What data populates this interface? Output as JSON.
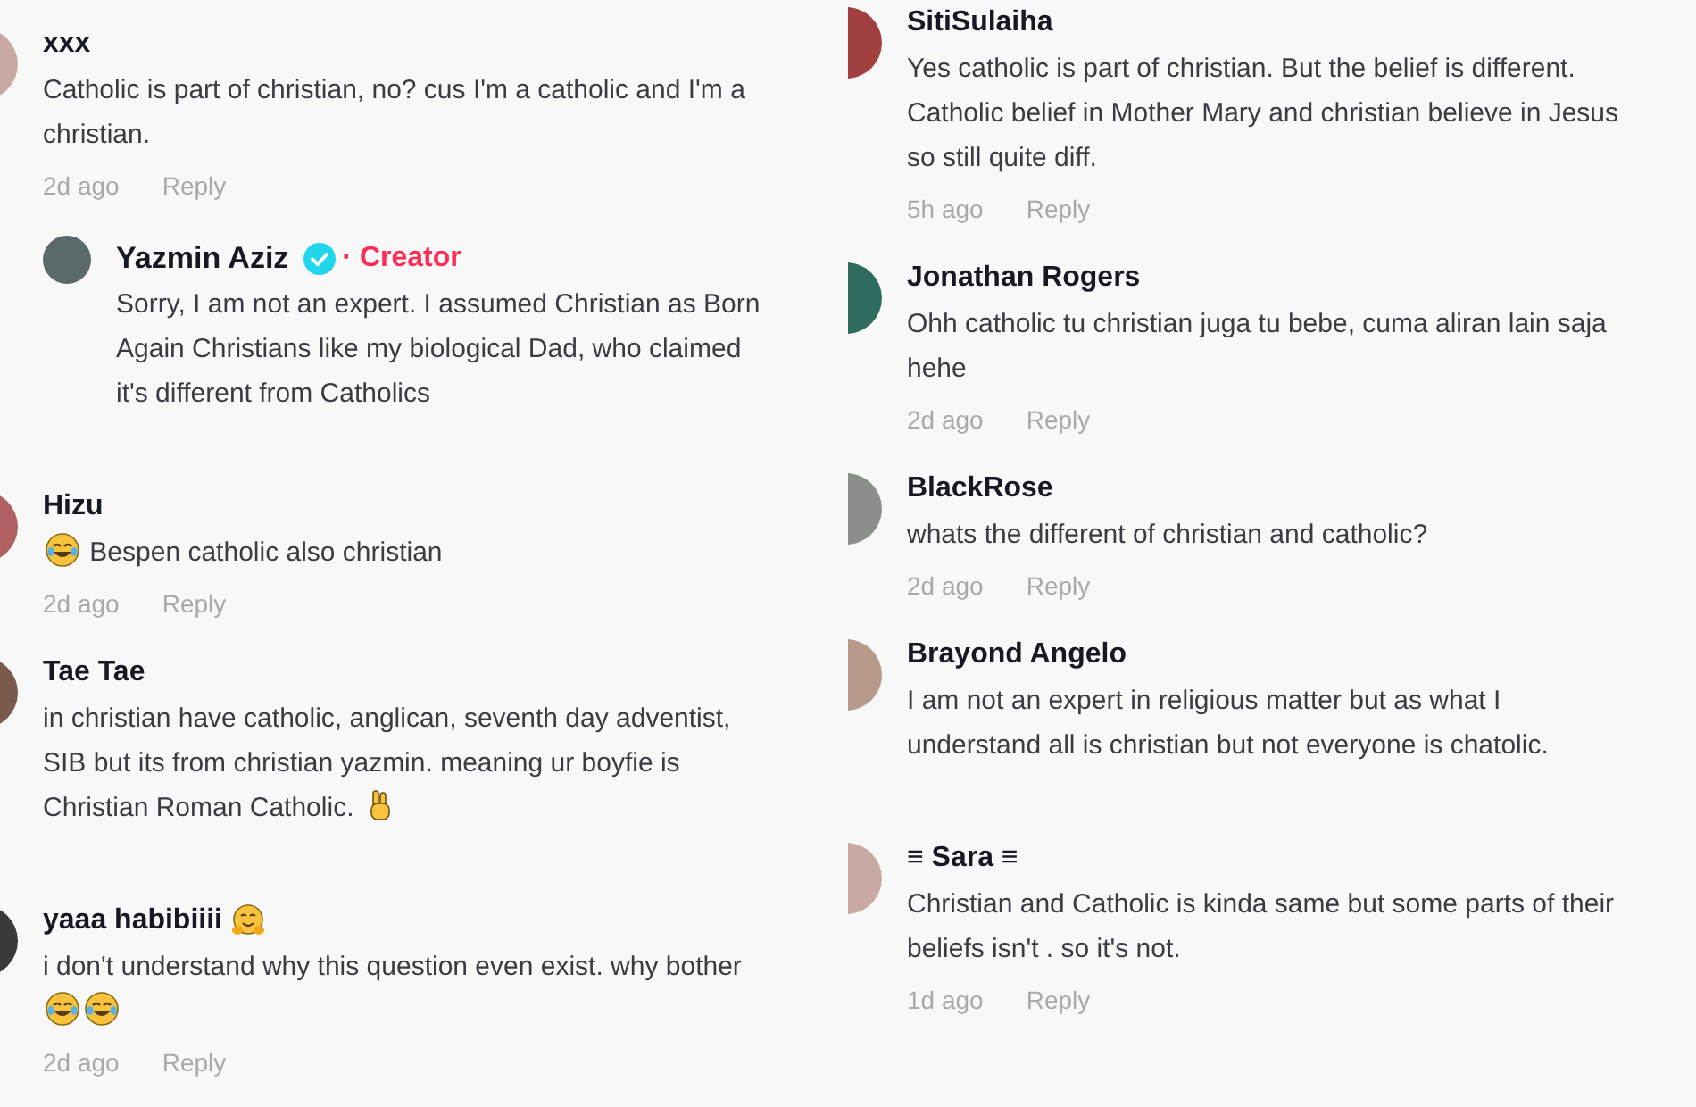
{
  "columns": [
    {
      "comments": [
        {
          "name": "xxx",
          "body": "Catholic is part of christian, no? cus I'm a catholic and I'm a christian.",
          "time": "2d ago",
          "reply": "Reply",
          "replies": [
            {
              "name": "Yazmin Aziz",
              "verified": true,
              "badge": "· Creator",
              "body": "Sorry, I am not an expert. I assumed Christian as Born Again Christians like my biological Dad, who claimed it's different from Catholics"
            }
          ]
        },
        {
          "name": "Hizu",
          "body_emojis_before": [
            {
              "kind": "tears-of-joy"
            }
          ],
          "body": "Bespen catholic also christian",
          "time": "2d ago",
          "reply": "Reply"
        },
        {
          "name": "Tae Tae",
          "body": "in christian have catholic, anglican, seventh day adventist, SIB but its from christian yazmin. meaning ur boyfie is Christian Roman Catholic.",
          "body_emojis_after": [
            {
              "kind": "victory-hand"
            }
          ]
        },
        {
          "name": "yaaa habibiiii",
          "name_emojis_after": [
            {
              "kind": "hugging"
            }
          ],
          "body": "i don't understand why this question even exist. why bother",
          "body_emojis_after": [
            {
              "kind": "tears-of-joy"
            },
            {
              "kind": "tears-of-joy"
            }
          ],
          "time": "2d ago",
          "reply": "Reply"
        }
      ]
    },
    {
      "comments": [
        {
          "name": "SitiSulaiha",
          "body": "Yes catholic is part of christian. But the belief is different. Catholic belief in Mother Mary and christian believe in Jesus so still quite diff.",
          "time": "5h ago",
          "reply": "Reply"
        },
        {
          "name": "Jonathan Rogers",
          "body": "Ohh catholic tu christian juga tu bebe, cuma aliran lain saja hehe",
          "time": "2d ago",
          "reply": "Reply"
        },
        {
          "name": "BlackRose",
          "body": "whats the different of christian and catholic?",
          "time": "2d ago",
          "reply": "Reply"
        },
        {
          "name": "Brayond Angelo",
          "body": "I am not an expert in religious matter but as what I understand all is christian but not everyone is chatolic."
        },
        {
          "name": "≡ Sara ≡",
          "body": "Christian and Catholic is kinda same but some parts of their beliefs isn't . so it's not.",
          "time": "1d ago",
          "reply": "Reply"
        }
      ]
    }
  ]
}
